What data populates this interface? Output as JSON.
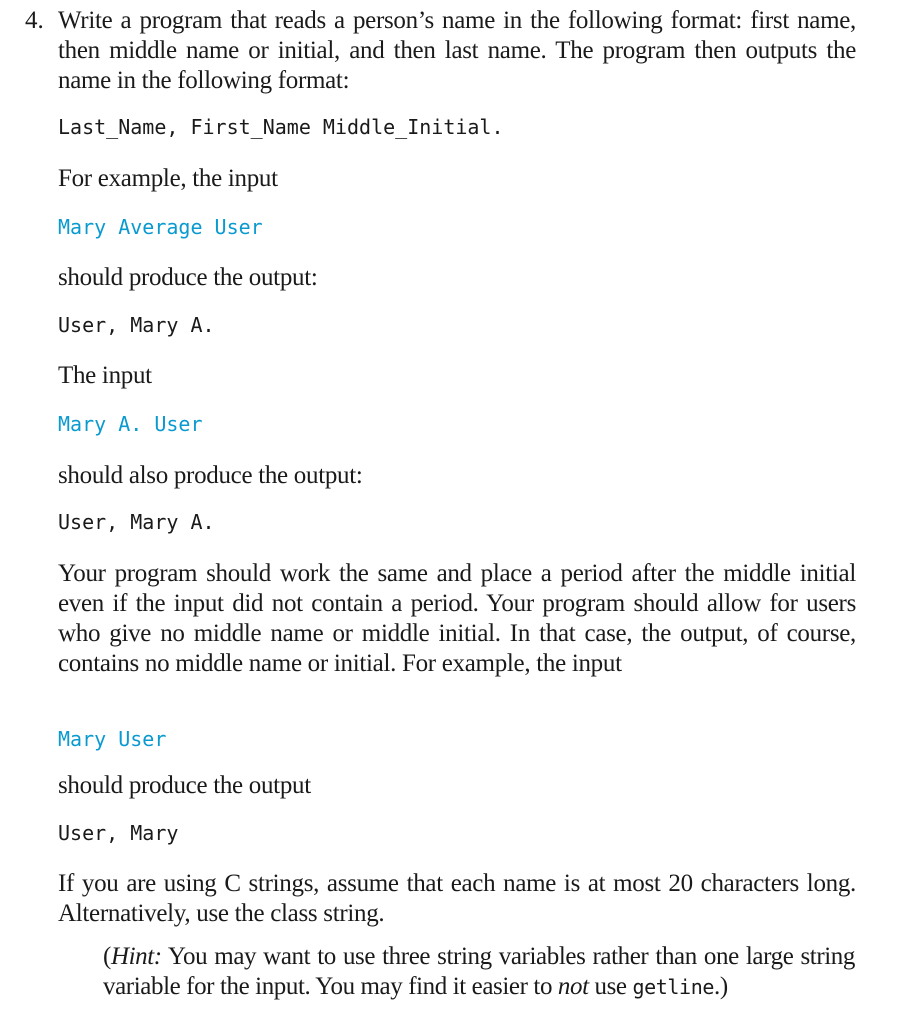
{
  "exercise": {
    "number": "4.",
    "intro": "Write a program that reads a person’s name in the following format: first name, then middle name or initial, and then last name. The program then outputs the name in the following format:",
    "format_code": "Last_Name, First_Name Middle_Initial.",
    "example1": {
      "lead": "For example, the input",
      "input": "Mary Average User",
      "result_label": "should produce the output:",
      "output": "User, Mary A."
    },
    "example2": {
      "lead": "The input",
      "input": "Mary A. User",
      "result_label": "should also produce the output:",
      "output": "User, Mary A."
    },
    "explanation": "Your program should work the same and place a period after the middle initial even if the input did not contain a period. Your program should allow for users who give no middle name or middle initial. In that case, the output, of course, contains no middle name or initial. For example, the input",
    "example3": {
      "input": "Mary User",
      "result_label": "should produce the output",
      "output": "User, Mary"
    },
    "cstring_note": "If you are using C strings, assume that each name is at most 20 characters long. Alternatively, use the class string.",
    "hint": {
      "open": "(",
      "label": "Hint:",
      "text1": " You may want to use three string variables rather than one large string variable for the input. You may find it easier to ",
      "emphasis": "not",
      "text2": " use ",
      "code": "getline",
      "close": ".)"
    }
  },
  "colors": {
    "text": "#1a1a1a",
    "input_code": "#0a9ad0"
  }
}
